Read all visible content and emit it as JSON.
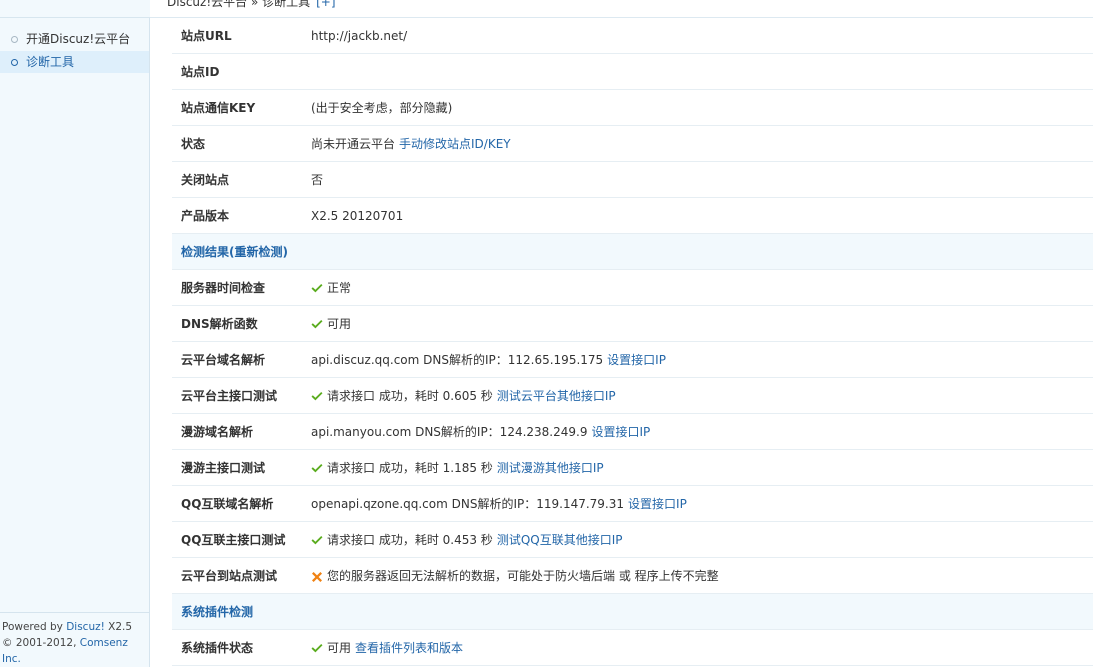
{
  "breadcrumb": {
    "text": "Discuz!云平台 » 诊断工具",
    "plus": "[+]"
  },
  "sidebar": {
    "items": [
      {
        "label": "开通Discuz!云平台",
        "active": false
      },
      {
        "label": "诊断工具",
        "active": true
      }
    ],
    "footer": {
      "powered_prefix": "Powered by ",
      "powered_link": "Discuz!",
      "powered_version": " X2.5",
      "copyright_prefix": "© 2001-2012, ",
      "copyright_link": "Comsenz Inc."
    }
  },
  "rows": {
    "site_url": {
      "label": "站点URL",
      "value": "http://jackb.net/"
    },
    "site_id": {
      "label": "站点ID",
      "value": ""
    },
    "site_key": {
      "label": "站点通信KEY",
      "value": "(出于安全考虑，部分隐藏)"
    },
    "status": {
      "label": "状态",
      "value": "尚未开通云平台",
      "link": "手动修改站点ID/KEY"
    },
    "closed": {
      "label": "关闭站点",
      "value": "否"
    },
    "version": {
      "label": "产品版本",
      "value": "X2.5 20120701"
    },
    "section_check": {
      "label": "检测结果(重新检测)"
    },
    "server_time": {
      "label": "服务器时间检查",
      "value": "正常"
    },
    "dns_func": {
      "label": "DNS解析函数",
      "value": "可用"
    },
    "cloud_dns": {
      "label": "云平台域名解析",
      "value": "api.discuz.qq.com DNS解析的IP：112.65.195.175",
      "link": "设置接口IP"
    },
    "cloud_api": {
      "label": "云平台主接口测试",
      "value": "请求接口 成功，耗时 0.605 秒",
      "link": "测试云平台其他接口IP"
    },
    "manyou_dns": {
      "label": "漫游域名解析",
      "value": "api.manyou.com DNS解析的IP：124.238.249.9",
      "link": "设置接口IP"
    },
    "manyou_api": {
      "label": "漫游主接口测试",
      "value": "请求接口 成功，耗时 1.185 秒",
      "link": "测试漫游其他接口IP"
    },
    "qq_dns": {
      "label": "QQ互联域名解析",
      "value": "openapi.qzone.qq.com DNS解析的IP：119.147.79.31",
      "link": "设置接口IP"
    },
    "qq_api": {
      "label": "QQ互联主接口测试",
      "value": "请求接口 成功，耗时 0.453 秒",
      "link": "测试QQ互联其他接口IP"
    },
    "cloud_site": {
      "label": "云平台到站点测试",
      "value": "您的服务器返回无法解析的数据，可能处于防火墙后端 或 程序上传不完整"
    },
    "section_plugin": {
      "label": "系统插件检测"
    },
    "plugin_status": {
      "label": "系统插件状态",
      "value": "可用",
      "link": "查看插件列表和版本"
    }
  },
  "colors": {
    "accent": "#2366a8",
    "ok": "#5aac1e",
    "error": "#f08213",
    "section_bg": "#f2f9fd"
  },
  "icons": {
    "ok": "check-icon",
    "error": "cross-icon"
  }
}
